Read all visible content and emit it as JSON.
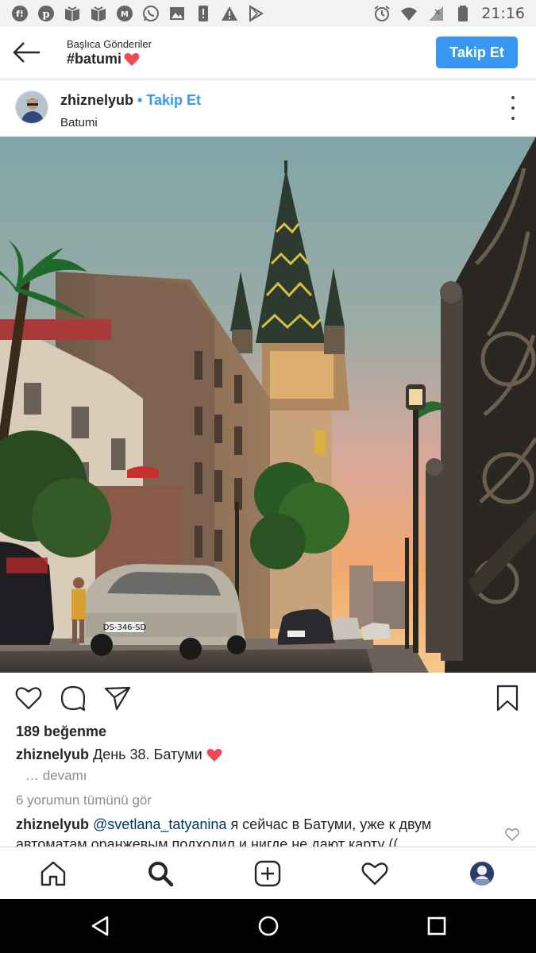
{
  "status_bar": {
    "time": "21:16",
    "left_icons": [
      "flipboard-icon",
      "pinterest-icon",
      "book-icon",
      "book-icon",
      "medium-icon",
      "whatsapp-icon",
      "image-icon",
      "phone-alert-icon",
      "warning-icon",
      "play-store-icon"
    ],
    "right_icons": [
      "alarm-icon",
      "wifi-icon",
      "signal-icon",
      "battery-icon"
    ]
  },
  "header": {
    "subtitle": "Başlıca Gönderiler",
    "title": "#batumi",
    "follow_label": "Takip Et",
    "accent": "#3897f0"
  },
  "post": {
    "username": "zhiznelyub",
    "separator": "•",
    "follow_label": "Takip Et",
    "location": "Batumi"
  },
  "photo": {
    "car_plate": "DS-346-SD"
  },
  "engagement": {
    "likes": "189 beğenme",
    "caption_user": "zhiznelyub",
    "caption_text": "День 38. Батуми",
    "more": "… devamı",
    "view_all_comments": "6 yorumun tümünü gör"
  },
  "comment": {
    "user": "zhiznelyub",
    "mention": "@svetlana_tatyanina",
    "text": "я сейчас в Батуми,  уже к двум автоматам оранжевым подходил и нигде не дают карту (("
  },
  "heart_color": "#ed4956"
}
